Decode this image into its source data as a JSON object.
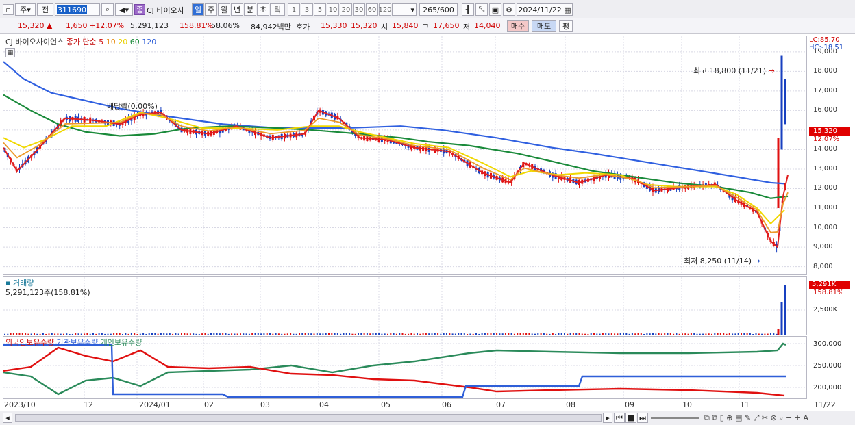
{
  "toolbar": {
    "period_label": "주",
    "prev_label": "전",
    "code": "311690",
    "stock_name": "CJ 바이오사",
    "spin_label": "종",
    "period_buttons": [
      "일",
      "주",
      "월",
      "년",
      "분",
      "초",
      "틱"
    ],
    "interval_buttons": [
      "1",
      "3",
      "5",
      "10",
      "20",
      "30",
      "60",
      "120"
    ],
    "count": "265",
    "count_total": "/600",
    "date": "2024/11/22"
  },
  "info": {
    "price": "15,320",
    "change": "1,650",
    "change_pct": "+12.07%",
    "volume": "5,291,123",
    "volume_ratio": "158.81%",
    "turnover_pct": "58.06%",
    "amount": "84,942백만",
    "bid_label": "호가",
    "bid1": "15,330",
    "bid2": "15,320",
    "open_label": "시",
    "open": "15,840",
    "high_label": "고",
    "high": "17,650",
    "low_label": "저",
    "low": "14,040",
    "buy_label": "매수",
    "sell_label": "매도",
    "eval_label": "평"
  },
  "legend": {
    "name": "CJ 바이오사이언스",
    "ma_label": "종가 단순",
    "ma": [
      "5",
      "10",
      "20",
      "60",
      "120"
    ]
  },
  "annotations": {
    "dividend": "배당락(0.00%)",
    "high": "최고 18,800 (11/21)",
    "low": "최저 8,250 (11/14)"
  },
  "right_axis": {
    "lc": "LC:85.70",
    "hc": "HC:-18.51",
    "price_tag": "15,320",
    "pct_tag": "12.07%"
  },
  "volume_panel": {
    "title": "거래량",
    "value": "5,291,123주(158.81%)",
    "tag": "5,291K",
    "tag_pct": "158.81%",
    "tick": "2,500K"
  },
  "holdings_panel": {
    "series": [
      "외국인보유수량",
      "기관보유수량",
      "개인보유수량"
    ],
    "ticks": [
      "300,000",
      "250,000",
      "200,000"
    ]
  },
  "x_labels": [
    "2023/10",
    "12",
    "2024/01",
    "02",
    "03",
    "04",
    "05",
    "06",
    "07",
    "08",
    "09",
    "10",
    "11",
    "11/22"
  ],
  "chart_data": {
    "type": "candlestick",
    "y_ticks": [
      19000,
      18000,
      17000,
      16000,
      15000,
      14000,
      13000,
      12000,
      11000,
      10000,
      9000,
      8000
    ],
    "ylim": [
      7600,
      19800
    ],
    "ma120": [
      [
        0,
        18500
      ],
      [
        30,
        17600
      ],
      [
        70,
        16900
      ],
      [
        120,
        16500
      ],
      [
        170,
        16100
      ],
      [
        240,
        15700
      ],
      [
        320,
        15300
      ],
      [
        400,
        15100
      ],
      [
        500,
        15100
      ],
      [
        580,
        15200
      ],
      [
        640,
        15000
      ],
      [
        720,
        14600
      ],
      [
        800,
        14100
      ],
      [
        860,
        13800
      ],
      [
        930,
        13400
      ],
      [
        1000,
        13000
      ],
      [
        1070,
        12600
      ],
      [
        1120,
        12300
      ],
      [
        1140,
        12250
      ]
    ],
    "ma60": [
      [
        0,
        16800
      ],
      [
        40,
        16000
      ],
      [
        80,
        15300
      ],
      [
        120,
        14900
      ],
      [
        170,
        14700
      ],
      [
        220,
        14800
      ],
      [
        270,
        15100
      ],
      [
        330,
        15200
      ],
      [
        400,
        15100
      ],
      [
        450,
        15000
      ],
      [
        520,
        14800
      ],
      [
        580,
        14600
      ],
      [
        620,
        14400
      ],
      [
        680,
        14200
      ],
      [
        750,
        13800
      ],
      [
        800,
        13400
      ],
      [
        860,
        12900
      ],
      [
        920,
        12600
      ],
      [
        980,
        12300
      ],
      [
        1040,
        12100
      ],
      [
        1090,
        11800
      ],
      [
        1120,
        11500
      ],
      [
        1145,
        11600
      ]
    ],
    "ma20": [
      [
        0,
        14600
      ],
      [
        30,
        14100
      ],
      [
        60,
        14500
      ],
      [
        100,
        15200
      ],
      [
        150,
        15200
      ],
      [
        200,
        15900
      ],
      [
        240,
        15600
      ],
      [
        290,
        15100
      ],
      [
        340,
        15100
      ],
      [
        400,
        15000
      ],
      [
        450,
        15200
      ],
      [
        490,
        15200
      ],
      [
        520,
        14900
      ],
      [
        560,
        14600
      ],
      [
        600,
        14300
      ],
      [
        650,
        14100
      ],
      [
        700,
        13300
      ],
      [
        740,
        12600
      ],
      [
        770,
        12900
      ],
      [
        810,
        12700
      ],
      [
        850,
        12800
      ],
      [
        900,
        12700
      ],
      [
        940,
        12200
      ],
      [
        980,
        12100
      ],
      [
        1040,
        12100
      ],
      [
        1070,
        11700
      ],
      [
        1100,
        11000
      ],
      [
        1120,
        10200
      ],
      [
        1140,
        10900
      ]
    ],
    "ma5": [
      [
        0,
        14100
      ],
      [
        20,
        12900
      ],
      [
        50,
        14000
      ],
      [
        90,
        15600
      ],
      [
        130,
        15500
      ],
      [
        170,
        15300
      ],
      [
        200,
        15800
      ],
      [
        230,
        15900
      ],
      [
        260,
        15000
      ],
      [
        300,
        14800
      ],
      [
        340,
        15200
      ],
      [
        390,
        14600
      ],
      [
        440,
        14800
      ],
      [
        460,
        16000
      ],
      [
        490,
        15600
      ],
      [
        520,
        14600
      ],
      [
        560,
        14500
      ],
      [
        600,
        14100
      ],
      [
        650,
        13900
      ],
      [
        700,
        12800
      ],
      [
        740,
        12300
      ],
      [
        760,
        13300
      ],
      [
        800,
        12700
      ],
      [
        840,
        12300
      ],
      [
        880,
        12700
      ],
      [
        920,
        12500
      ],
      [
        950,
        11900
      ],
      [
        1000,
        12100
      ],
      [
        1040,
        12200
      ],
      [
        1070,
        11400
      ],
      [
        1100,
        10800
      ],
      [
        1120,
        9300
      ],
      [
        1130,
        9000
      ],
      [
        1138,
        11600
      ],
      [
        1145,
        12700
      ]
    ]
  }
}
